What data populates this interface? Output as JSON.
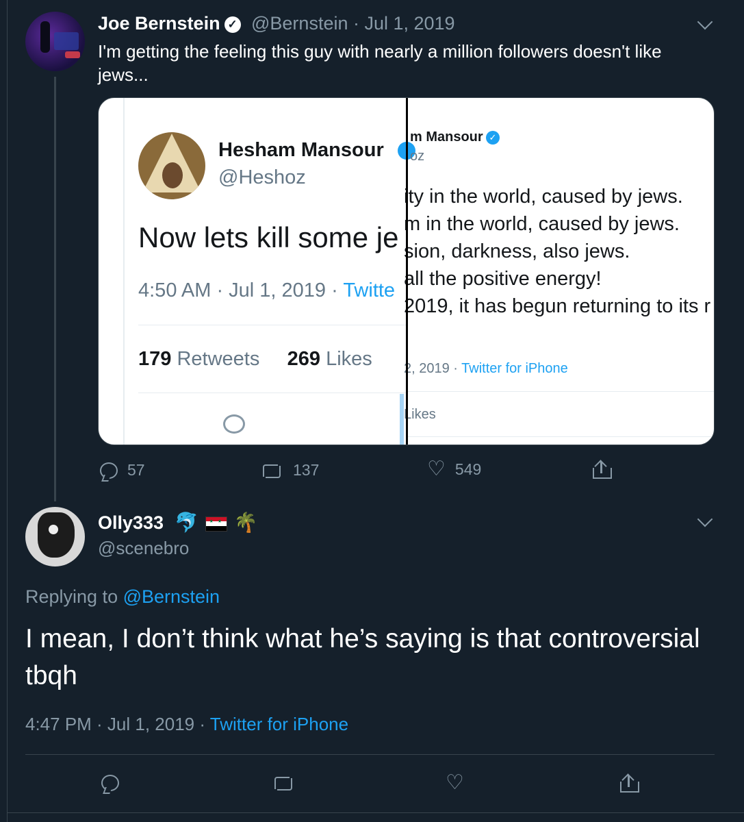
{
  "tweet1": {
    "name": "Joe Bernstein",
    "handle_date": "@Bernstein · Jul 1, 2019",
    "text": "I'm getting the feeling this guy with nearly a million followers doesn't like jews...",
    "replies": "57",
    "retweets": "137",
    "likes": "549"
  },
  "embedded_left": {
    "name": "Hesham Mansour",
    "handle": "@Heshoz",
    "text": "Now lets kill some je",
    "time": "4:50 AM · Jul 1, 2019 · ",
    "source": "Twitte",
    "retweets_count": "179",
    "retweets_label": "Retweets",
    "likes_count": "269",
    "likes_label": "Likes"
  },
  "embedded_right": {
    "name": "m Mansour",
    "handle": "oz",
    "lines": [
      "ity in the world, caused by jews.",
      "m in the world, caused by jews.",
      "sion, darkness, also jews.",
      "all the positive energy!",
      "2019, it has begun returning to its r"
    ],
    "date": "2, 2019 · ",
    "source": "Twitter for iPhone",
    "likes": "Likes"
  },
  "tweet2": {
    "name": "Olly333",
    "emoji_dolphin": "🐬",
    "emoji_palm": "🌴",
    "handle": "@scenebro",
    "replying_label": "Replying to ",
    "replying_mention": "@Bernstein",
    "text": "I mean, I don’t think what he’s saying is that controversial tbqh",
    "time": "4:47 PM · Jul 1, 2019 · ",
    "source": "Twitter for iPhone"
  },
  "icons": {
    "verified": "✓",
    "heart": "♡"
  },
  "colors": {
    "background": "#15202b",
    "secondary_text": "#8899a6",
    "link": "#1da1f2",
    "border": "#38444d"
  }
}
